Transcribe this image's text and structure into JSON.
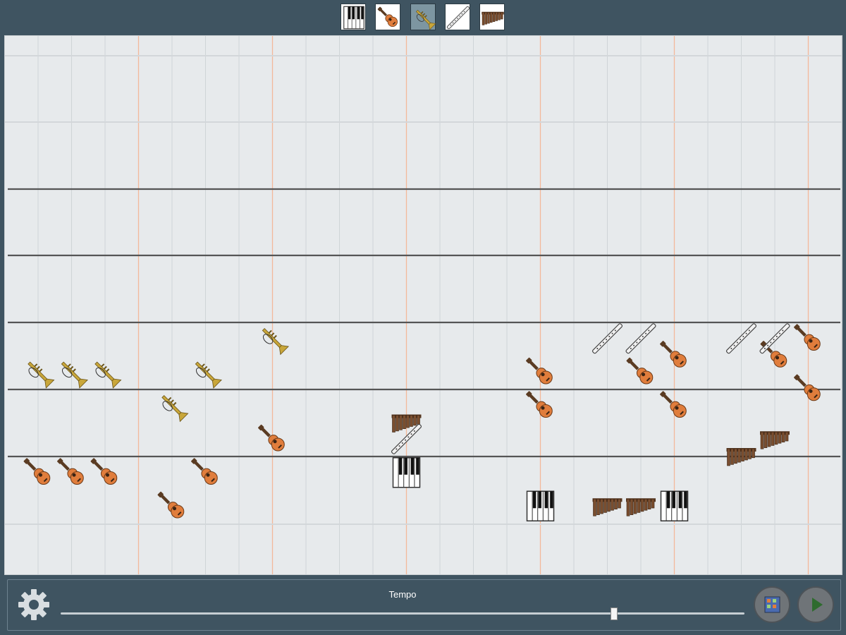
{
  "toolbar": {
    "instruments": [
      {
        "icon": "piano-icon",
        "selected": false
      },
      {
        "icon": "guitar-icon",
        "selected": false
      },
      {
        "icon": "trumpet-icon",
        "selected": true
      },
      {
        "icon": "flute-icon",
        "selected": false
      },
      {
        "icon": "panflute-icon",
        "selected": false
      }
    ]
  },
  "controls": {
    "tempo_label": "Tempo",
    "tempo_level": 0.81,
    "settings_icon": "gear-icon",
    "layout_button_icon": "grid-icon",
    "play_button_icon": "play-icon"
  },
  "colors": {
    "chrome": "#3f5461",
    "canvas": "#e7eaec",
    "bar_line": "#f3b99a",
    "staff_line": "#555555",
    "guitar": "#e07d3c",
    "trumpet": "#c8a63a",
    "panflute": "#7a4e2f",
    "play": "#2e6b2e"
  },
  "score": {
    "notes": [
      {
        "instrument": "trumpet",
        "beat": 0,
        "pitch": 5
      },
      {
        "instrument": "trumpet",
        "beat": 1,
        "pitch": 5
      },
      {
        "instrument": "trumpet",
        "beat": 2,
        "pitch": 5
      },
      {
        "instrument": "trumpet",
        "beat": 5,
        "pitch": 5
      },
      {
        "instrument": "trumpet",
        "beat": 4,
        "pitch": 3
      },
      {
        "instrument": "trumpet",
        "beat": 7,
        "pitch": 7
      },
      {
        "instrument": "guitar",
        "beat": 0,
        "pitch": -1
      },
      {
        "instrument": "guitar",
        "beat": 1,
        "pitch": -1
      },
      {
        "instrument": "guitar",
        "beat": 2,
        "pitch": -1
      },
      {
        "instrument": "guitar",
        "beat": 5,
        "pitch": -1
      },
      {
        "instrument": "guitar",
        "beat": 4,
        "pitch": -3
      },
      {
        "instrument": "guitar",
        "beat": 7,
        "pitch": 1
      },
      {
        "instrument": "guitar",
        "beat": 15,
        "pitch": 5
      },
      {
        "instrument": "guitar",
        "beat": 15,
        "pitch": 3
      },
      {
        "instrument": "guitar",
        "beat": 18,
        "pitch": 5
      },
      {
        "instrument": "guitar",
        "beat": 19,
        "pitch": 3
      },
      {
        "instrument": "guitar",
        "beat": 19,
        "pitch": 6
      },
      {
        "instrument": "guitar",
        "beat": 22,
        "pitch": 6
      },
      {
        "instrument": "guitar",
        "beat": 23,
        "pitch": 7
      },
      {
        "instrument": "guitar",
        "beat": 23,
        "pitch": 4
      },
      {
        "instrument": "panflute",
        "beat": 11,
        "pitch": 2
      },
      {
        "instrument": "panflute",
        "beat": 22,
        "pitch": 1
      },
      {
        "instrument": "panflute",
        "beat": 21,
        "pitch": 0
      },
      {
        "instrument": "panflute",
        "beat": 17,
        "pitch": -3
      },
      {
        "instrument": "panflute",
        "beat": 18,
        "pitch": -3
      },
      {
        "instrument": "flute",
        "beat": 11,
        "pitch": 1
      },
      {
        "instrument": "flute",
        "beat": 17,
        "pitch": 7
      },
      {
        "instrument": "flute",
        "beat": 18,
        "pitch": 7
      },
      {
        "instrument": "flute",
        "beat": 21,
        "pitch": 7
      },
      {
        "instrument": "flute",
        "beat": 22,
        "pitch": 7
      },
      {
        "instrument": "piano",
        "beat": 11,
        "pitch": -1
      },
      {
        "instrument": "piano",
        "beat": 15,
        "pitch": -3
      },
      {
        "instrument": "piano",
        "beat": 19,
        "pitch": -3
      }
    ]
  }
}
